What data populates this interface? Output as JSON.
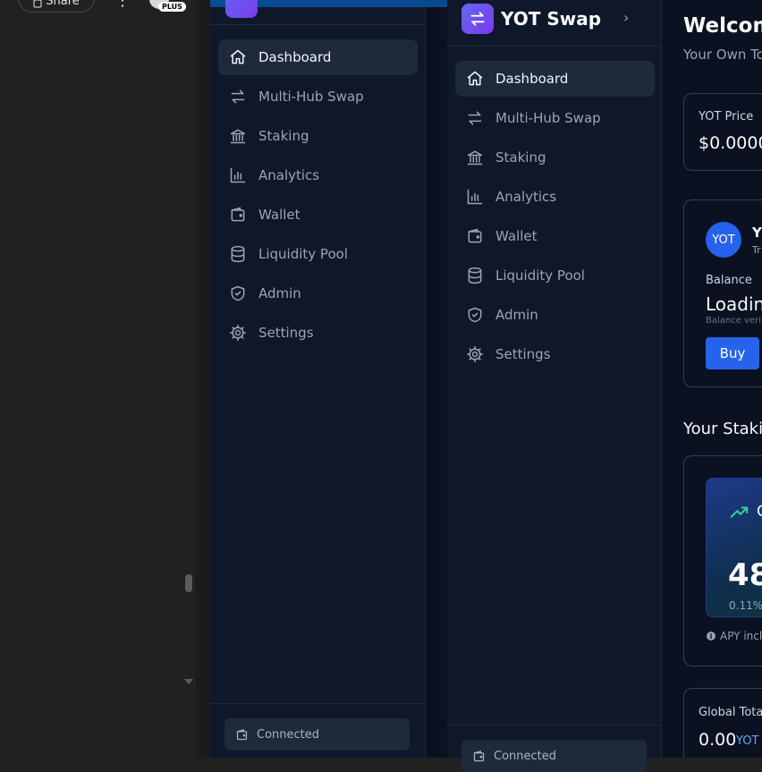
{
  "chat": {
    "share_label": "Share",
    "more_glyph": "⋮",
    "plan_badge": "PLUS"
  },
  "app": {
    "brand_name": "YOT Swap",
    "nav_items": [
      {
        "label": "Dashboard",
        "icon": "home-icon",
        "active": true
      },
      {
        "label": "Multi-Hub Swap",
        "icon": "swap-arrows-icon",
        "active": false
      },
      {
        "label": "Staking",
        "icon": "bank-icon",
        "active": false
      },
      {
        "label": "Analytics",
        "icon": "bar-chart-icon",
        "active": false
      },
      {
        "label": "Wallet",
        "icon": "wallet-icon",
        "active": false
      },
      {
        "label": "Liquidity Pool",
        "icon": "database-icon",
        "active": false
      },
      {
        "label": "Admin",
        "icon": "shield-check-icon",
        "active": false
      },
      {
        "label": "Settings",
        "icon": "gear-icon",
        "active": false
      }
    ],
    "connected_label": "Connected"
  },
  "main": {
    "welcome_title": "Welcom",
    "welcome_subtitle": "Your Own To",
    "price_card": {
      "label": "YOT Price",
      "value": "$0.0000"
    },
    "token_card": {
      "avatar_text": "YOT",
      "name_partial": "Y",
      "sub_partial": "Tr",
      "balance_label": "Balance",
      "balance_value": "Loadin",
      "balance_note": "Balance veri",
      "buy_label": "Buy"
    },
    "staking_title": "Your Staki",
    "staking_card": {
      "title_partial": "C",
      "value_partial": "48",
      "sub_partial": "0.11%",
      "apy_note": "APY inclu"
    },
    "global_card": {
      "label": "Global Total",
      "value": "0.00",
      "unit": "YOT"
    }
  },
  "colors": {
    "accent": "#2563eb",
    "brand_gradient_start": "#6366f1",
    "brand_gradient_end": "#7c3aed",
    "trend_green": "#34d399"
  }
}
